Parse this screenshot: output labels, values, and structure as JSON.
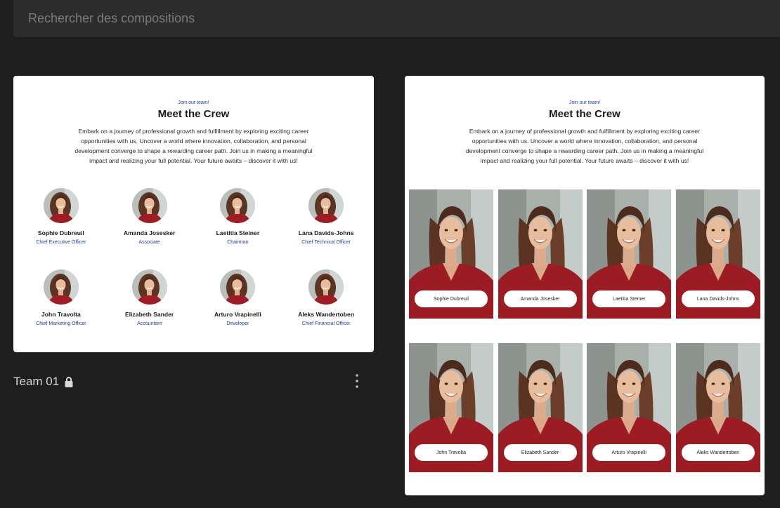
{
  "search": {
    "placeholder": "Rechercher des compositions"
  },
  "card1": {
    "tagline": "Join our team!",
    "headline": "Meet the Crew",
    "intro": "Embark on a journey of professional growth and fulfillment by exploring exciting career opportunities with us. Uncover a world where innovation, collaboration, and personal development converge to shape a rewarding career path. Join us in making a meaningful impact and realizing your full potential. Your future awaits – discover it with us!",
    "members": [
      {
        "name": "Sophie Dubreuil",
        "role": "Chief Executive Officer"
      },
      {
        "name": "Amanda Josesker",
        "role": "Associate"
      },
      {
        "name": "Laetitia Steiner",
        "role": "Chairman"
      },
      {
        "name": "Lana Davids-Johns",
        "role": "Chief Technical Officer"
      },
      {
        "name": "John Travolta",
        "role": "Chief Marketing Officer"
      },
      {
        "name": "Elizabeth Sander",
        "role": "Accountant"
      },
      {
        "name": "Arturo Vrapinelli",
        "role": "Developer"
      },
      {
        "name": "Aleks Wandertoben",
        "role": "Chief Financial Officer"
      }
    ],
    "title": "Team 01"
  },
  "card2": {
    "tagline": "Join our team!",
    "headline": "Meet the Crew",
    "intro": "Embark on a journey of professional growth and fulfillment by exploring exciting career opportunities with us. Uncover a world where innovation, collaboration, and personal development converge to shape a rewarding career path. Join us in making a meaningful impact and realizing your full potential. Your future awaits – discover it with us!",
    "members": [
      {
        "name": "Sophie Dubreuil"
      },
      {
        "name": "Amanda Josesker"
      },
      {
        "name": "Laetitia Steiner"
      },
      {
        "name": "Lana Davids-Johns"
      },
      {
        "name": "John Travolta"
      },
      {
        "name": "Elizabeth Sander"
      },
      {
        "name": "Arturo Vrapinelli"
      },
      {
        "name": "Aleks Wandertoben"
      }
    ]
  },
  "icons": {
    "lock": "lock-icon",
    "more": "more-vertical-icon"
  },
  "colors": {
    "accent": "#1d3fa8",
    "background": "#1e1e1e",
    "search_bg": "#2c2c2c"
  }
}
